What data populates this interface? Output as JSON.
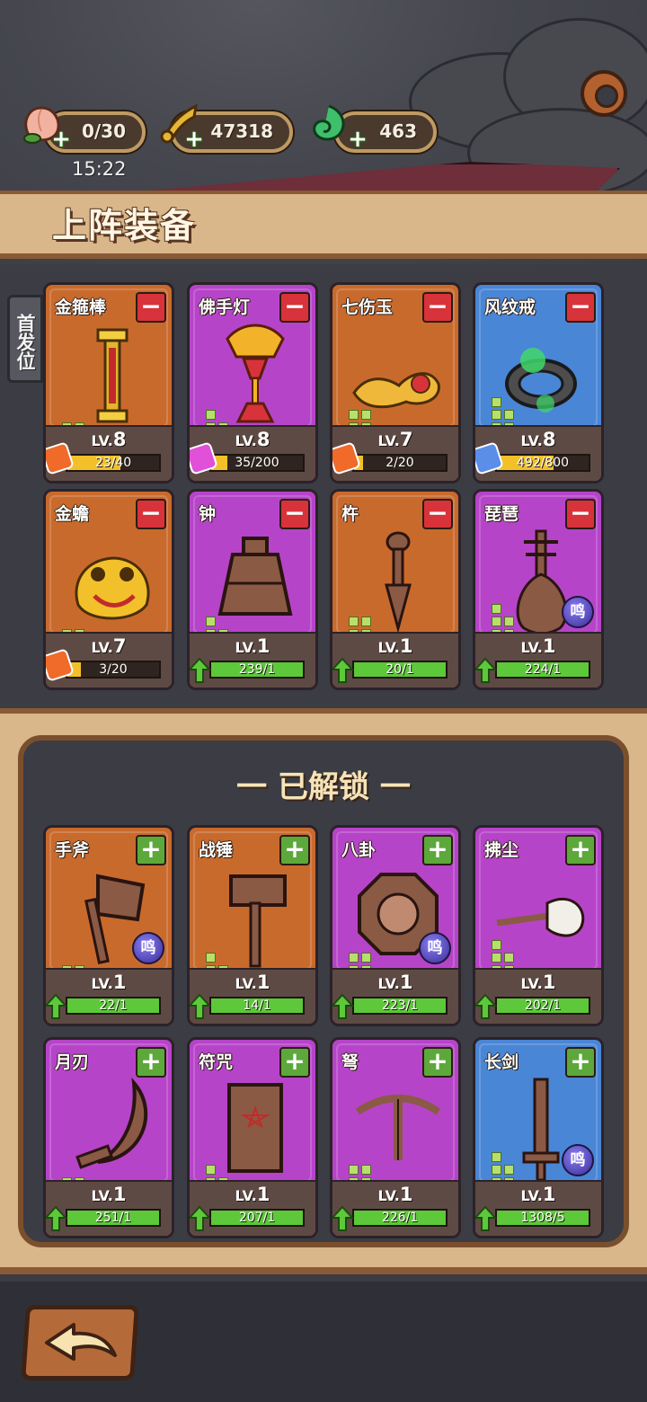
{
  "status": {
    "time": "15:22"
  },
  "resources": [
    {
      "name": "peach",
      "value": "0/30",
      "color": "#f2b2a0"
    },
    {
      "name": "gold-scroll",
      "value": "47318",
      "color": "#e6b636"
    },
    {
      "name": "jade",
      "value": "463",
      "color": "#3fbf6a"
    }
  ],
  "header": {
    "title": "上阵装备"
  },
  "side_tab": {
    "label": "首发位"
  },
  "equipped": [
    {
      "name": "金箍棒",
      "rarity": "orange",
      "level": "8",
      "progress": "23/40",
      "fill": 0.575,
      "mode": "piece"
    },
    {
      "name": "佛手灯",
      "rarity": "purple",
      "level": "8",
      "progress": "35/200",
      "fill": 0.175,
      "mode": "piece"
    },
    {
      "name": "七伤玉",
      "rarity": "orange",
      "level": "7",
      "progress": "2/20",
      "fill": 0.1,
      "mode": "piece"
    },
    {
      "name": "风纹戒",
      "rarity": "blue",
      "level": "8",
      "progress": "492/800",
      "fill": 0.615,
      "mode": "piece"
    },
    {
      "name": "金蟾",
      "rarity": "orange",
      "level": "7",
      "progress": "3/20",
      "fill": 0.15,
      "mode": "piece"
    },
    {
      "name": "钟",
      "rarity": "purple",
      "level": "1",
      "progress": "239/1",
      "fill": 1,
      "mode": "upgrade"
    },
    {
      "name": "杵",
      "rarity": "orange",
      "level": "1",
      "progress": "20/1",
      "fill": 1,
      "mode": "upgrade"
    },
    {
      "name": "琵琶",
      "rarity": "purple",
      "level": "1",
      "progress": "224/1",
      "fill": 1,
      "mode": "upgrade",
      "ming": "鸣"
    }
  ],
  "unlocked": {
    "title": "一 已解锁 一",
    "items": [
      {
        "name": "手斧",
        "rarity": "orange",
        "level": "1",
        "progress": "22/1",
        "fill": 1,
        "ming": "鸣"
      },
      {
        "name": "战锤",
        "rarity": "orange",
        "level": "1",
        "progress": "14/1",
        "fill": 1
      },
      {
        "name": "八卦",
        "rarity": "purple",
        "level": "1",
        "progress": "223/1",
        "fill": 1,
        "ming": "鸣"
      },
      {
        "name": "拂尘",
        "rarity": "purple",
        "level": "1",
        "progress": "202/1",
        "fill": 1
      },
      {
        "name": "月刃",
        "rarity": "purple",
        "level": "1",
        "progress": "251/1",
        "fill": 1
      },
      {
        "name": "符咒",
        "rarity": "purple",
        "level": "1",
        "progress": "207/1",
        "fill": 1
      },
      {
        "name": "弩",
        "rarity": "purple",
        "level": "1",
        "progress": "226/1",
        "fill": 1
      },
      {
        "name": "长剑",
        "rarity": "blue",
        "level": "1",
        "progress": "1308/5",
        "fill": 1,
        "ming": "鸣"
      }
    ]
  },
  "labels": {
    "lv": "LV.",
    "minus": "−",
    "plus": "+"
  },
  "colors": {
    "orange": "#c96a2d",
    "purple": "#b644c9",
    "blue": "#4a86d6",
    "progress_yellow": "#f2c12a",
    "progress_green": "#5cc83a"
  }
}
